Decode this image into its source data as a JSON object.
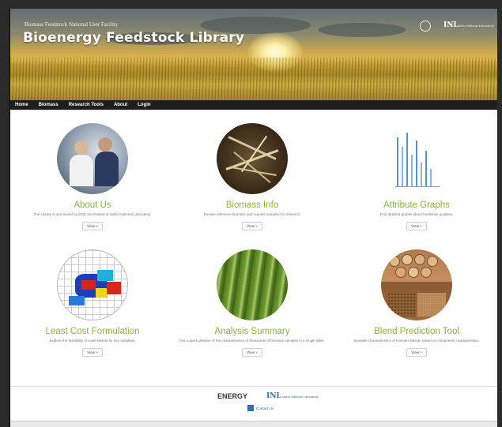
{
  "header": {
    "kicker": "Biomass Feedstock National User Facility",
    "title": "Bioenergy Feedstock Library",
    "logo_inl": "INL",
    "logo_inl_sub": "Idaho National Laboratory"
  },
  "nav": {
    "items": [
      "Home",
      "Biomass",
      "Research Tools",
      "About",
      "Login"
    ]
  },
  "cards": [
    {
      "title": "About Us",
      "desc": "The Library is sponsored by DOE and hosted at Idaho National Laboratory.",
      "button": "View »",
      "icon": "researchers-photo"
    },
    {
      "title": "Biomass Info",
      "desc": "Review reference biomass and request samples for research.",
      "button": "View »",
      "icon": "biomass-straw-photo"
    },
    {
      "title": "Attribute Graphs",
      "desc": "Find detailed graphs about feedstock qualities.",
      "button": "View »",
      "icon": "bar-graph-image"
    },
    {
      "title": "Least Cost Formulation",
      "desc": "Explore the feasibility of scale blends for key variables.",
      "button": "View »",
      "icon": "heat-map-image"
    },
    {
      "title": "Analysis Summary",
      "desc": "Get a quick glimpse of the characteristics of thousands of biomass samples in a single table.",
      "button": "View »",
      "icon": "plant-stalks-photo"
    },
    {
      "title": "Blend Prediction Tool",
      "desc": "Simulate characteristics of biomass blends based on component characteristics.",
      "button": "View »",
      "icon": "wood-pellets-photo"
    }
  ],
  "footer": {
    "energy_logo": "ENERGY",
    "inl_logo": "INL",
    "inl_sub": "Idaho National Laboratory",
    "contact": "Contact Us"
  },
  "colors": {
    "accent_green": "#8cb33c",
    "nav_bg": "#1e1e1e",
    "link_blue": "#3a6da8"
  }
}
